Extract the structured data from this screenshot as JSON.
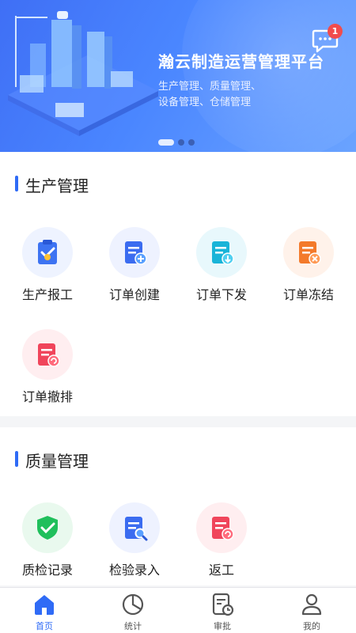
{
  "banner": {
    "title": "瀚云制造运营管理平台",
    "subtitle_line1": "生产管理、质量管理、",
    "subtitle_line2": "设备管理、仓储管理",
    "slides": 3,
    "active_slide": 1,
    "message_badge": "1"
  },
  "production": {
    "title": "生产管理",
    "items": [
      {
        "label": "生产报工",
        "icon": "clipboard-report-icon"
      },
      {
        "label": "订单创建",
        "icon": "order-add-icon"
      },
      {
        "label": "订单下发",
        "icon": "order-dispatch-icon"
      },
      {
        "label": "订单冻结",
        "icon": "order-freeze-icon"
      },
      {
        "label": "订单撤排",
        "icon": "order-revoke-icon"
      }
    ]
  },
  "quality": {
    "title": "质量管理",
    "items": [
      {
        "label": "质检记录",
        "icon": "shield-check-icon"
      },
      {
        "label": "检验录入",
        "icon": "inspect-search-icon"
      },
      {
        "label": "返工",
        "icon": "rework-icon"
      }
    ]
  },
  "tabbar": {
    "items": [
      {
        "label": "首页",
        "icon": "home-icon",
        "active": true
      },
      {
        "label": "统计",
        "icon": "pie-chart-icon",
        "active": false
      },
      {
        "label": "审批",
        "icon": "approval-icon",
        "active": false
      },
      {
        "label": "我的",
        "icon": "user-icon",
        "active": false
      }
    ]
  },
  "colors": {
    "accent": "#2f6bf6",
    "badge": "#f14c4c"
  }
}
